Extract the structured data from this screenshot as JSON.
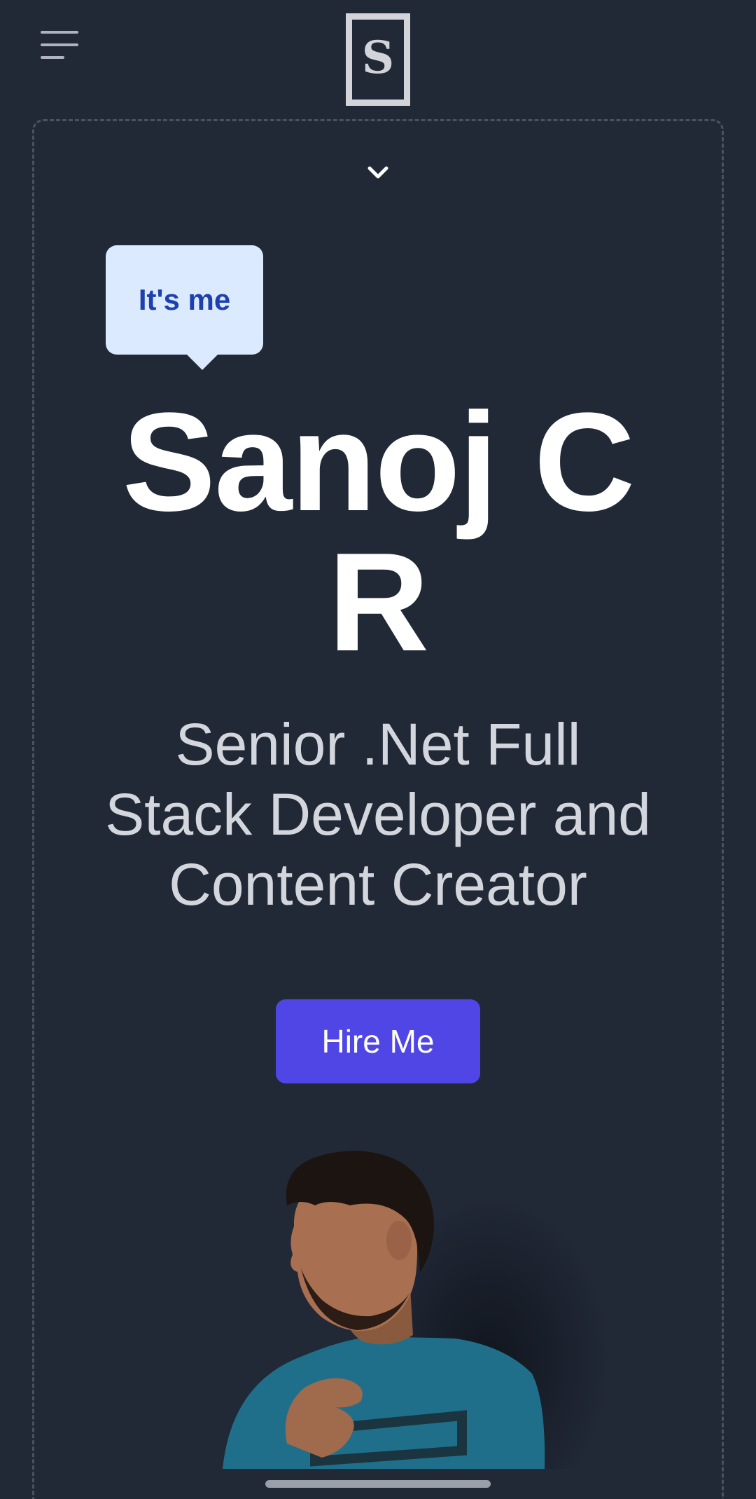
{
  "header": {
    "menu_icon": "hamburger-menu-icon",
    "logo_letter": "S"
  },
  "hero": {
    "scroll_icon": "chevron-down-icon",
    "bubble_text": "It's me",
    "name_line1": "Sanoj C",
    "name_line2": "R",
    "role_line1": "Senior .Net Full",
    "role_line2": "Stack Developer and",
    "role_line3": "Content Creator",
    "hire_label": "Hire Me",
    "portrait": "person-portrait-photo"
  },
  "colors": {
    "background": "#212836",
    "accent": "#4f46e5",
    "bubble_bg": "#dbeafe",
    "bubble_text": "#1e40af",
    "heading": "#ffffff",
    "subtext": "#d4d6dd"
  }
}
